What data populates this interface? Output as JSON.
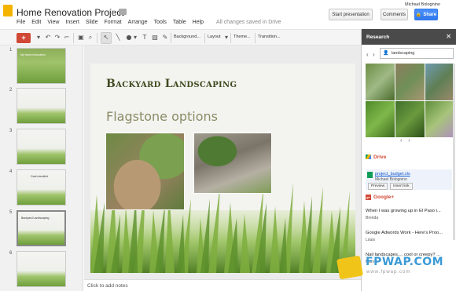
{
  "app": {
    "doc_title": "Home Renovation Project",
    "menu": [
      "File",
      "Edit",
      "View",
      "Insert",
      "Slide",
      "Format",
      "Arrange",
      "Tools",
      "Table",
      "Help"
    ],
    "save_status": "All changes saved in Drive",
    "user": "Michael Bolognino",
    "start_presentation": "Start presentation",
    "comments": "Comments",
    "share": "Share"
  },
  "toolbar": {
    "background": "Background...",
    "layout": "Layout",
    "theme": "Theme...",
    "transition": "Transition..."
  },
  "thumbs": [
    {
      "num": "1",
      "title": "My home renovation"
    },
    {
      "num": "2",
      "title": ""
    },
    {
      "num": "3",
      "title": ""
    },
    {
      "num": "4",
      "title": "Goal checklist"
    },
    {
      "num": "5",
      "title": "Backyard Landscaping"
    },
    {
      "num": "6",
      "title": ""
    }
  ],
  "slide": {
    "title": "Backyard Landscaping",
    "subtitle": "Flagstone options"
  },
  "notes_placeholder": "Click to add notes",
  "research": {
    "title": "Research",
    "query": "landscaping",
    "drive_label": "Drive",
    "file_name": "project_budget.xls",
    "file_owner": "Michael Bolognino",
    "preview": "Preview",
    "insert_link": "Insert link",
    "gplus_label": "Google+",
    "results": [
      {
        "title": "When I was growing up in El Paso i...",
        "author": "Brenda"
      },
      {
        "title": "Google Adwords Work - Here's Proo...",
        "author": "Louis"
      },
      {
        "title": "Nail landscapes.... cool or creepy? ...",
        "author": "Marvin"
      }
    ]
  },
  "watermark": {
    "text": "FPWAP.COM",
    "sub": "www.fpwap.com"
  }
}
